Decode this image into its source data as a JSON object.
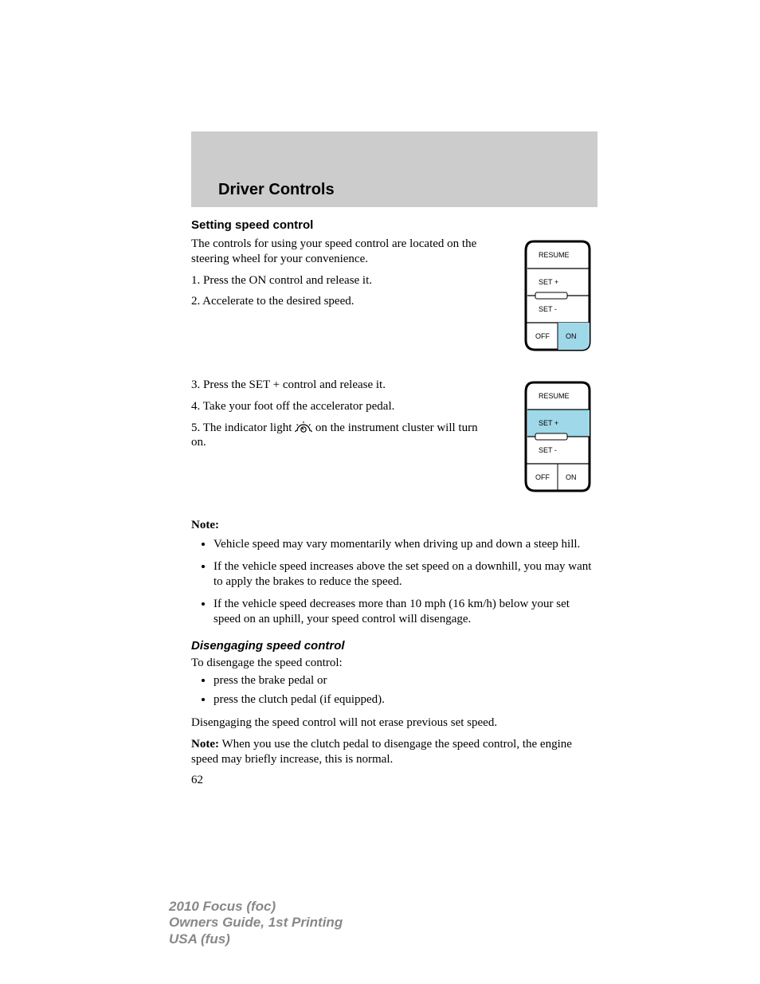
{
  "header": {
    "title": "Driver Controls"
  },
  "section1": {
    "title": "Setting speed control",
    "intro": "The controls for using your speed control are located on the steering wheel for your convenience.",
    "step1": "1. Press the ON control and release it.",
    "step2": "2. Accelerate to the desired speed.",
    "step3": "3. Press the SET + control and release it.",
    "step4": "4. Take your foot off the accelerator pedal.",
    "step5a": "5. The indicator light ",
    "step5b": " on the instrument cluster will turn on."
  },
  "keypad": {
    "resume": "RESUME",
    "setplus": "SET  +",
    "setminus": "SET  -",
    "off": "OFF",
    "on": "ON"
  },
  "notes": {
    "label": "Note:",
    "items": [
      "Vehicle speed may vary momentarily when driving up and down a steep hill.",
      "If the vehicle speed increases above the set speed on a downhill, you may want to apply the brakes to reduce the speed.",
      "If the vehicle speed decreases more than 10 mph (16 km/h) below your set speed on an uphill, your speed control will disengage."
    ]
  },
  "section2": {
    "title": "Disengaging speed control",
    "intro": "To disengage the speed control:",
    "items": [
      "press the brake pedal or",
      "press the clutch pedal (if equipped)."
    ],
    "after": "Disengaging the speed control will not erase previous set speed.",
    "noteLabel": "Note:",
    "noteBody": " When you use the clutch pedal to disengage the speed control, the engine speed may briefly increase, this is normal."
  },
  "pageNumber": "62",
  "footer": {
    "line1a": "2010 Focus ",
    "line1b": "(foc)",
    "line2": "Owners Guide, 1st Printing",
    "line3a": "USA ",
    "line3b": "(fus)"
  },
  "colors": {
    "highlight": "#9ed8e9"
  }
}
